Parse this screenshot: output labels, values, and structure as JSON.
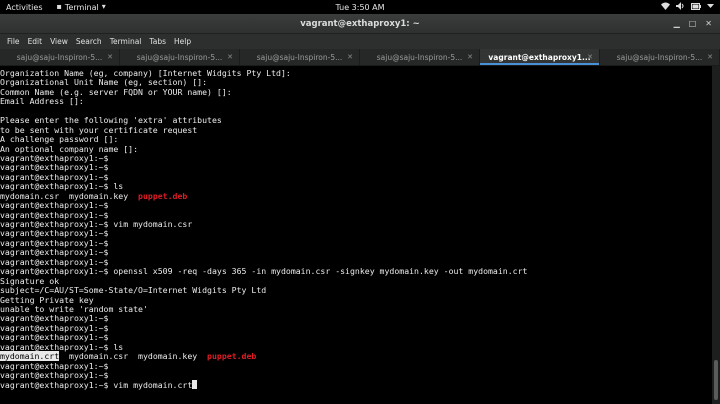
{
  "topbar": {
    "activities": "Activities",
    "app_menu": "Terminal",
    "app_menu_arrow": "▾",
    "clock": "Tue  3:50 AM",
    "icons": [
      "wifi-icon",
      "volume-icon",
      "battery-icon",
      "power-menu-icon"
    ]
  },
  "window": {
    "title": "vagrant@exthaproxy1: ~"
  },
  "menu": [
    "File",
    "Edit",
    "View",
    "Search",
    "Terminal",
    "Tabs",
    "Help"
  ],
  "tabs": [
    {
      "label": "saju@saju-Inspiron-5...",
      "active": false
    },
    {
      "label": "saju@saju-Inspiron-5...",
      "active": false
    },
    {
      "label": "saju@saju-Inspiron-5...",
      "active": false
    },
    {
      "label": "saju@saju-Inspiron-5...",
      "active": false
    },
    {
      "label": "vagrant@exthaproxy1...",
      "active": true
    },
    {
      "label": "saju@saju-Inspiron-5...",
      "active": false
    }
  ],
  "terminal": {
    "lines": [
      [
        {
          "t": "Organization Name (eg, company) [Internet Widgits Pty Ltd]:"
        }
      ],
      [
        {
          "t": "Organizational Unit Name (eg, section) []:"
        }
      ],
      [
        {
          "t": "Common Name (e.g. server FQDN or YOUR name) []:"
        }
      ],
      [
        {
          "t": "Email Address []:"
        }
      ],
      [
        {
          "t": ""
        }
      ],
      [
        {
          "t": "Please enter the following 'extra' attributes"
        }
      ],
      [
        {
          "t": "to be sent with your certificate request"
        }
      ],
      [
        {
          "t": "A challenge password []:"
        }
      ],
      [
        {
          "t": "An optional company name []:"
        }
      ],
      [
        {
          "t": "vagrant@exthaproxy1:~$"
        }
      ],
      [
        {
          "t": "vagrant@exthaproxy1:~$"
        }
      ],
      [
        {
          "t": "vagrant@exthaproxy1:~$"
        }
      ],
      [
        {
          "t": "vagrant@exthaproxy1:~$ ls"
        }
      ],
      [
        {
          "t": "mydomain.csr  mydomain.key  "
        },
        {
          "t": "puppet.deb",
          "c": "red"
        }
      ],
      [
        {
          "t": "vagrant@exthaproxy1:~$"
        }
      ],
      [
        {
          "t": "vagrant@exthaproxy1:~$"
        }
      ],
      [
        {
          "t": "vagrant@exthaproxy1:~$ vim mydomain.csr"
        }
      ],
      [
        {
          "t": "vagrant@exthaproxy1:~$"
        }
      ],
      [
        {
          "t": "vagrant@exthaproxy1:~$"
        }
      ],
      [
        {
          "t": "vagrant@exthaproxy1:~$"
        }
      ],
      [
        {
          "t": "vagrant@exthaproxy1:~$"
        }
      ],
      [
        {
          "t": "vagrant@exthaproxy1:~$ openssl x509 -req -days 365 -in mydomain.csr -signkey mydomain.key -out mydomain.crt"
        }
      ],
      [
        {
          "t": "Signature ok"
        }
      ],
      [
        {
          "t": "subject=/C=AU/ST=Some-State/O=Internet Widgits Pty Ltd"
        }
      ],
      [
        {
          "t": "Getting Private key"
        }
      ],
      [
        {
          "t": "unable to write 'random state'"
        }
      ],
      [
        {
          "t": "vagrant@exthaproxy1:~$"
        }
      ],
      [
        {
          "t": "vagrant@exthaproxy1:~$"
        }
      ],
      [
        {
          "t": "vagrant@exthaproxy1:~$"
        }
      ],
      [
        {
          "t": "vagrant@exthaproxy1:~$ ls"
        }
      ],
      [
        {
          "t": "mydomain.crt",
          "c": "hl"
        },
        {
          "t": "  mydomain.csr  mydomain.key  "
        },
        {
          "t": "puppet.deb",
          "c": "red"
        }
      ],
      [
        {
          "t": "vagrant@exthaproxy1:~$"
        }
      ],
      [
        {
          "t": "vagrant@exthaproxy1:~$"
        }
      ],
      [
        {
          "t": "vagrant@exthaproxy1:~$ vim mydomain.crt"
        },
        {
          "cursor": true
        }
      ]
    ]
  }
}
